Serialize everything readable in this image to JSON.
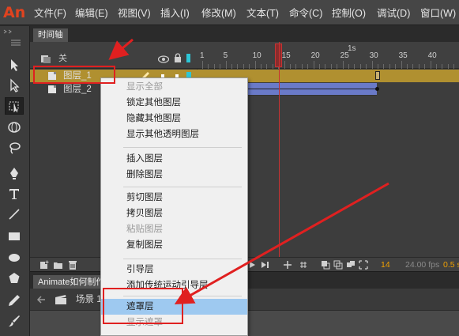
{
  "app": {
    "logo": "An"
  },
  "menubar": {
    "items": [
      "文件(F)",
      "编辑(E)",
      "视图(V)",
      "插入(I)",
      "修改(M)",
      "文本(T)",
      "命令(C)",
      "控制(O)",
      "调试(D)",
      "窗口(W)"
    ]
  },
  "timeline": {
    "tab_label": "时间轴",
    "header": {
      "layer_column_label": "关",
      "seconds_marker": "1s"
    },
    "ruler": {
      "ticks": [
        "1",
        "5",
        "10",
        "15",
        "20",
        "25",
        "30",
        "35",
        "40"
      ],
      "playhead_frame": 13
    },
    "layers": [
      {
        "name": "图层_1",
        "selected": true
      },
      {
        "name": "图层_2",
        "selected": false
      }
    ],
    "footer": {
      "current_frame": "14",
      "frame_rate": "24.00 fps",
      "elapsed": "0.5 s"
    }
  },
  "stage": {
    "tab_label": "Animate如何制作",
    "scene_label": "场景 1"
  },
  "context_menu": {
    "items": [
      {
        "label": "显示全部",
        "disabled": true
      },
      {
        "label": "锁定其他图层"
      },
      {
        "label": "隐藏其他图层"
      },
      {
        "label": "显示其他透明图层"
      },
      {
        "separator": true
      },
      {
        "label": "插入图层"
      },
      {
        "label": "删除图层"
      },
      {
        "separator": true
      },
      {
        "label": "剪切图层"
      },
      {
        "label": "拷贝图层"
      },
      {
        "label": "粘贴图层",
        "disabled": true
      },
      {
        "label": "复制图层"
      },
      {
        "separator": true
      },
      {
        "label": "引导层"
      },
      {
        "label": "添加传统运动引导层"
      },
      {
        "separator": true
      },
      {
        "label": "遮罩层",
        "highlighted": true
      },
      {
        "label": "显示遮罩",
        "disabled": true
      }
    ]
  },
  "colors": {
    "annotation": "#e02020",
    "selected_layer": "#b09030",
    "menu_highlight": "#9ec9f0",
    "playhead": "#c83232",
    "panel_bg": "#3c3c3c"
  },
  "icons": {
    "layer_header": "layer-folder-icon",
    "visibility": "eye-icon",
    "lock": "lock-icon",
    "outline": "outline-icon",
    "tools": [
      "selection-tool-icon",
      "subselection-tool-icon",
      "free-transform-tool-icon",
      "3d-rotation-tool-icon",
      "lasso-tool-icon",
      "pen-tool-icon",
      "text-tool-icon",
      "line-tool-icon",
      "rectangle-tool-icon",
      "oval-tool-icon",
      "polystar-tool-icon",
      "pencil-tool-icon",
      "brush-tool-icon"
    ],
    "timeline_footer": [
      "new-layer-icon",
      "new-folder-icon",
      "delete-layer-icon",
      "play-icon",
      "step-forward-icon",
      "center-frame-icon",
      "loop-icon",
      "onion-skin-icon",
      "onion-outline-icon",
      "edit-multiple-frames-icon",
      "onion-markers-icon"
    ],
    "scene": [
      "back-arrow-icon",
      "clapper-icon"
    ]
  }
}
